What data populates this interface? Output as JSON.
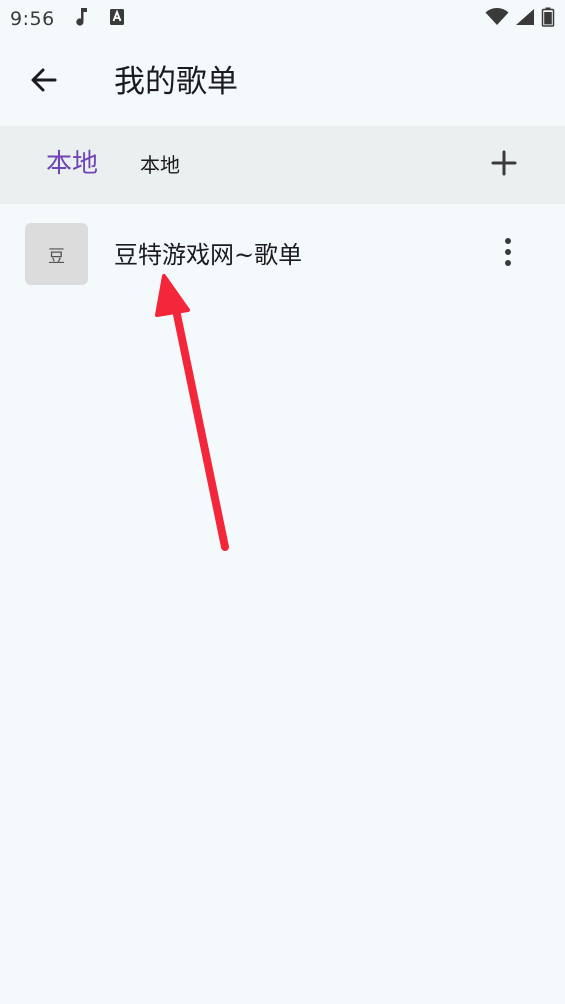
{
  "status_bar": {
    "time": "9:56",
    "icons": [
      "music-note-icon",
      "text-a-icon",
      "wifi-icon",
      "signal-icon",
      "battery-icon"
    ]
  },
  "app_bar": {
    "title": "我的歌单",
    "back_icon": "arrow-left-icon"
  },
  "tabs": {
    "active_label": "本地",
    "inactive_label": "本地",
    "add_icon": "plus-icon"
  },
  "playlists": [
    {
      "thumb_text": "豆",
      "name": "豆特游戏网~歌单",
      "menu_icon": "more-vertical-icon"
    }
  ],
  "colors": {
    "background": "#f4fafb",
    "tab_bar": "#eaeff0",
    "accent": "#6f45b8",
    "annotation_arrow": "#f3263a"
  }
}
